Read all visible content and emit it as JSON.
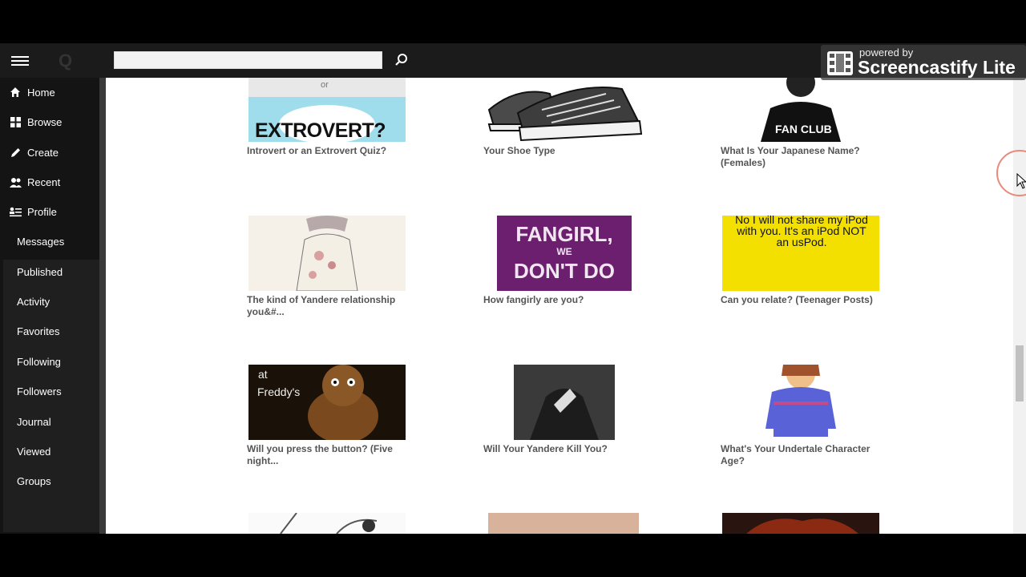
{
  "sidebar": {
    "main_items": [
      {
        "label": "Home",
        "icon": "home-icon"
      },
      {
        "label": "Browse",
        "icon": "grid-icon"
      },
      {
        "label": "Create",
        "icon": "pencil-icon"
      },
      {
        "label": "Recent",
        "icon": "users-icon"
      },
      {
        "label": "Profile",
        "icon": "profile-list-icon"
      }
    ],
    "sub_items": [
      "Messages",
      "Published",
      "Activity",
      "Favorites",
      "Following",
      "Followers",
      "Journal",
      "Viewed",
      "Groups"
    ]
  },
  "watermark": {
    "powered_by": "powered by",
    "brand": "Screencastify Lite"
  },
  "quizzes": [
    {
      "title": "Introvert or an Extrovert Quiz?",
      "thumb_text_top": "or",
      "thumb_text_main": "EXTROVERT?"
    },
    {
      "title": "Your Shoe Type"
    },
    {
      "title": "What Is Your Japanese Name? (Females)",
      "thumb_text_main": "FAN CLUB"
    },
    {
      "title": "The kind of Yandere relationship you&#..."
    },
    {
      "title": "How fangirly are you?",
      "thumb_text_main": "FANGIRL,",
      "thumb_text_mid": "WE",
      "thumb_text_bottom": "DON'T DO"
    },
    {
      "title": "Can you relate? (Teenager Posts)",
      "thumb_text_main": "No I will not share my iPod with you. It's an iPod NOT an usPod."
    },
    {
      "title": "Will you press the button? (Five night...",
      "thumb_text_top": "at",
      "thumb_text_main": "Freddy's"
    },
    {
      "title": "Will Your Yandere Kill You?"
    },
    {
      "title": "What's Your Undertale Character Age?"
    }
  ],
  "colors": {
    "topbar": "#1b1b1b",
    "sidebar": "#141414",
    "fangirl_bg": "#6b1f6e",
    "teen_bg": "#f3e000",
    "title_text": "#555555"
  }
}
